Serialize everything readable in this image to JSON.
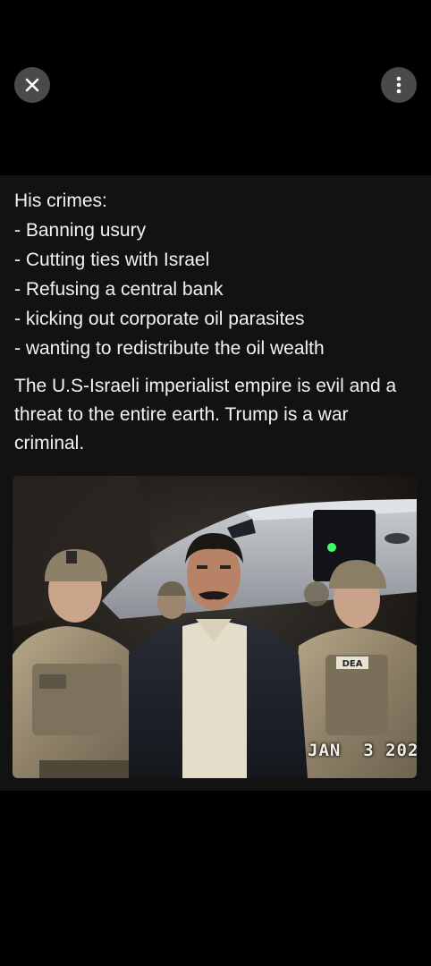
{
  "viewer": {
    "close_icon": "close-icon",
    "more_icon": "more-vertical-icon"
  },
  "post": {
    "heading": "His crimes:",
    "crimes": [
      "- Banning usury",
      "- Cutting ties with Israel",
      "- Refusing a central bank",
      "- kicking out corporate oil parasites",
      "- wanting to redistribute the oil wealth"
    ],
    "paragraph": "The U.S-Israeli imperialist empire is evil and a threat to the entire earth. Trump is a war criminal.",
    "photo": {
      "timestamp": "JAN  3 202",
      "vest_patch": "DEA"
    }
  },
  "colors": {
    "background": "#000000",
    "post_background": "#121212",
    "text": "#f2f2f2",
    "button_background": "#4a4a4a"
  }
}
